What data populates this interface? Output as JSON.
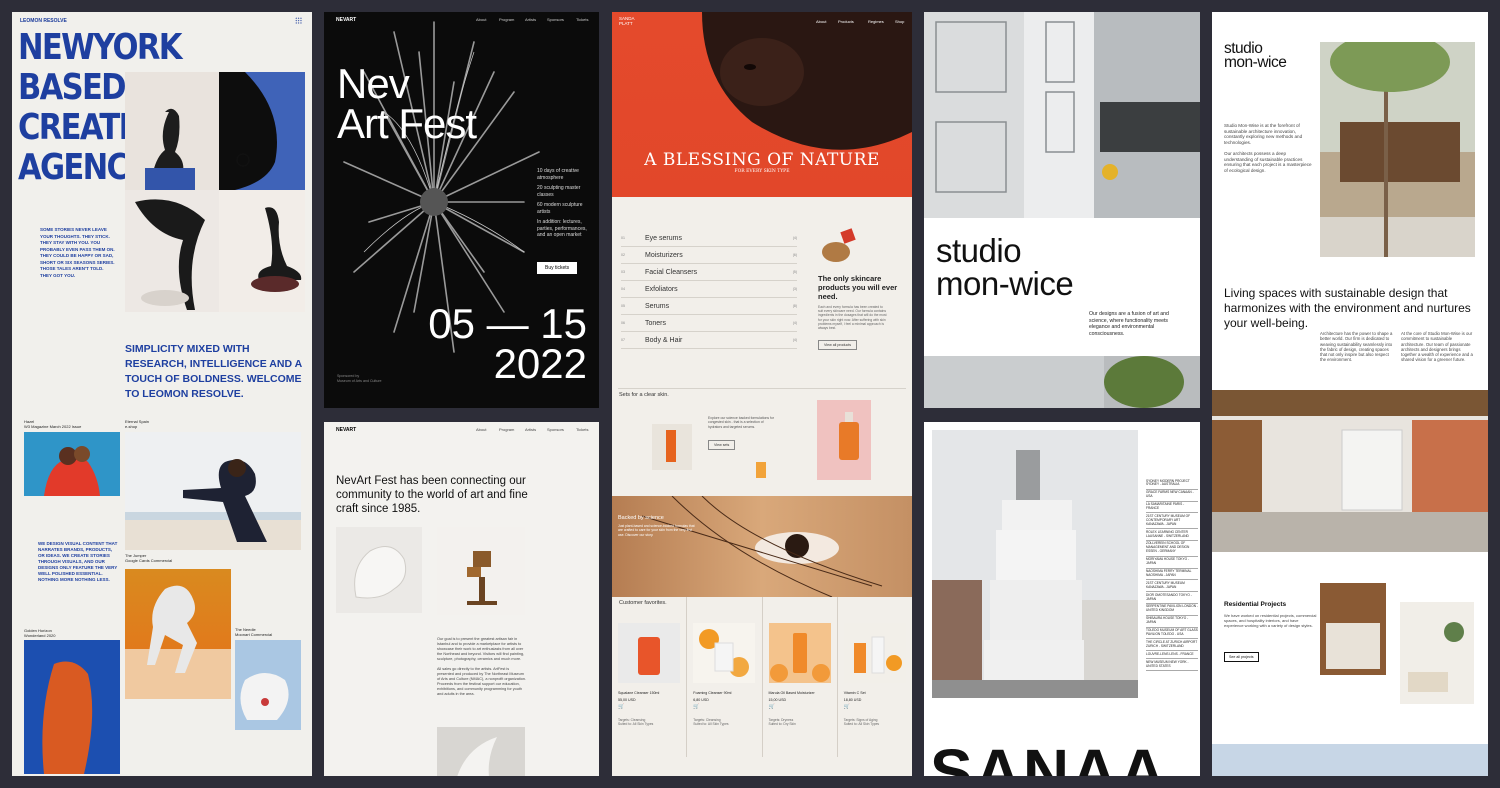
{
  "panel1": {
    "brand": "LEOMON RESOLVE",
    "hero": "NEWYORK BASED CREATIVE AGENCY",
    "side_text": "SOME STORIES NEVER LEAVE YOUR THOUGHTS. THEY STICK. THEY STAY WITH YOU. YOU PROBABLY EVEN PASS THEM ON. THEY COULD BE HAPPY OR SAD, SHORT OR SIX SEASONS SERIES. THOSE TALES AREN'T TOLD. THEY GOT YOU.",
    "tagline": "SIMPLICITY MIXED WITH RESEARCH, INTELLIGENCE AND A TOUCH OF BOLDNESS. WELCOME TO LEOMON RESOLVE.",
    "cap1_a": "Hazel",
    "cap1_b": "W3 Magazine March 2022 Issue",
    "cap2_a": "Eternal Spain",
    "cap2_b": "e-shop",
    "body_text": "WE DESIGN VISUAL CONTENT THAT NARRATES BRANDS, PRODUCTS, OR IDEAS. WE CREATE STORIES THROUGH VISUALS, AND OUR DESIGNS ONLY FEATURE THE VERY WELL POLISHED ESSENTIAL. NOTHING MORE NOTHING LESS.",
    "cap3_a": "The Jumper",
    "cap3_b": "Google Cards Commercial",
    "cap4_a": "Golden Horizon",
    "cap4_b": "Wonderland 2020",
    "cap5_a": "The Needle",
    "cap5_b": "Moonart Commercial"
  },
  "panel2": {
    "logo": "NEVART",
    "nav": [
      "About",
      "Program",
      "Artists",
      "Sponsors",
      "Tickets"
    ],
    "title_line1": "Nev",
    "title_line2": "Art Fest",
    "info": [
      "10 days of creative atmosphere",
      "20 sculpting master classes",
      "60 modern sculpture artists",
      "In addition: lectures, parties, performances, and an open market"
    ],
    "button": "Buy tickets",
    "dates_line1": "05 — 15",
    "dates_line2": "2022",
    "sponsor": "Sponsored by\nMuseum of Arts and Culture"
  },
  "panel3": {
    "logo": "NEVART",
    "nav": [
      "About",
      "Program",
      "Artists",
      "Sponsors",
      "Tickets"
    ],
    "headline": "NevArt Fest has been connecting our community to the world of art and fine craft since 1985.",
    "body1": "Our goal is to present the greatest artisan fair in Istanbul and to provide a marketplace for artists to showcase their work to art enthusiasts from all over the Northeast and beyond. Visitors will find painting, sculpture, photography, ceramics and much more.",
    "body2": "All sales go directly to the artists. ArtFest is presented and produced by The Northeast Museum of Arts and Culture (NMAC), a nonprofit organization. Proceeds from the festival support our education, exhibitions, and community programming for youth and adults in the area."
  },
  "panel4": {
    "brand_line1": "SANDA",
    "brand_line2": "PLATT",
    "nav": [
      "About",
      "Products",
      "Regimes",
      "Shop"
    ],
    "headline": "A BLESSING OF NATURE",
    "sub": "FOR EVERY SKIN TYPE",
    "menu": [
      {
        "num": "01",
        "label": "Eye serums",
        "count": "(4)"
      },
      {
        "num": "02",
        "label": "Moisturizers",
        "count": "(6)"
      },
      {
        "num": "03",
        "label": "Facial Cleansers",
        "count": "(5)"
      },
      {
        "num": "04",
        "label": "Exfoliators",
        "count": "(3)"
      },
      {
        "num": "05",
        "label": "Serums",
        "count": "(8)"
      },
      {
        "num": "06",
        "label": "Toners",
        "count": "(4)"
      },
      {
        "num": "07",
        "label": "Body & Hair",
        "count": "(4)"
      }
    ],
    "only_title": "The only skincare products you will ever need.",
    "only_body": "Each and every formula has been created to suit every skincare need. Our formula contains ingredients in the dosages that will do the most for your skin right now. After suffering with skin problems myself, I feel a minimal approach is always best.",
    "view_all": "View all products",
    "sets_title": "Sets for a clear skin.",
    "sets_body": "Explore our science backed formulations for congested skin - that is a selection of hydrators and targeted serums.",
    "view_sets": "View sets",
    "backed": "Backed by science",
    "backed_body": "Just plant-based and science-backed formulas that are crafted to care for your skin from the very first use. Discover our story.",
    "fav_title": "Customer favorites.",
    "products": [
      {
        "name": "Squalane Cleanser 150ml",
        "price": "55,00 USD",
        "desc": "Targets: Cleansing\nSuited to: All Skin Types"
      },
      {
        "name": "Foaming Cleanser 90ml",
        "price": "6,80 USD",
        "desc": "Targets: Cleansing\nSuited to: All Skin Types"
      },
      {
        "name": "Marula Oil Based Moisturizer",
        "price": "15,00 USD",
        "desc": "Targets: Dryness\nSuited to: Dry Skin"
      },
      {
        "name": "Vitamin C Set",
        "price": "18,80 USD",
        "desc": "Targets: Signs of Aging\nSuited to: All Skin Types"
      }
    ]
  },
  "panel5": {
    "title_line1": "studio",
    "title_line2": "mon-wice",
    "desc": "Our designs are a fusion of art and science, where functionality meets elegance and environmental consciousness."
  },
  "panel6": {
    "list": [
      "SYDNEY MODERN PROJECT SYDNEY - AUSTRALIA",
      "GRACE FARMS NEW CANAAN - USA",
      "LA SAMARITAINE PARIS - FRANCE",
      "21ST CENTURY MUSEUM OF CONTEMPORARY ART KANAZAWA - JAPAN",
      "ROLEX LEARNING CENTER LAUSANNE - SWITZERLAND",
      "ZOLLVEREIN SCHOOL OF MANAGEMENT AND DESIGN ESSEN - GERMANY",
      "MORIYAMA HOUSE TOKYO - JAPAN",
      "NAOSHIMA FERRY TERMINAL NAOSHIMA - JAPAN",
      "21ST CENTURY MUSEUM KANAZAWA - JAPAN",
      "DIOR OMOTESANDO TOKYO - JAPAN",
      "SERPENTINE PAVILION LONDON - UNITED KINGDOM",
      "SHIBAURA HOUSE TOKYO - JAPAN",
      "TOLEDO MUSEUM OF ART GLASS PAVILION TOLEDO - USA",
      "THE CIRCLE AT ZURICH AIRPORT ZURICH - SWITZERLAND",
      "LOUVRE-LENS LENS - FRANCE",
      "NEW MUSEUM NEW YORK - UNITED STATES"
    ],
    "big_word": "SANAA"
  },
  "panel7": {
    "logo_line1": "studio",
    "logo_line2": "mon-wice",
    "intro1": "Studio Mon-Wise is at the forefront of sustainable architecture innovation, constantly exploring new methods and technologies.",
    "intro2": "Our architects possess a deep understanding of sustainable practices ensuring that each project is a masterpiece of ecological design.",
    "headline": "Living spaces with sustainable design that harmonizes with the environment and nurtures your well-being.",
    "col1": "Architecture has the power to shape a better world. Our firm is dedicated to weaving sustainability seamlessly into the fabric of design, creating spaces that not only inspire but also respect the environment.",
    "col2": "At the core of Studio Mon-Wise is our commitment to sustainable architecture. Our team of passionate architects and designers brings together a wealth of experience and a shared vision for a greener future.",
    "res_title": "Residential Projects",
    "res_body": "We have worked on residential projects, commercial spaces, and hospitality interiors, and have experience working with a variety of design styles.",
    "res_btn": "See all projects"
  }
}
